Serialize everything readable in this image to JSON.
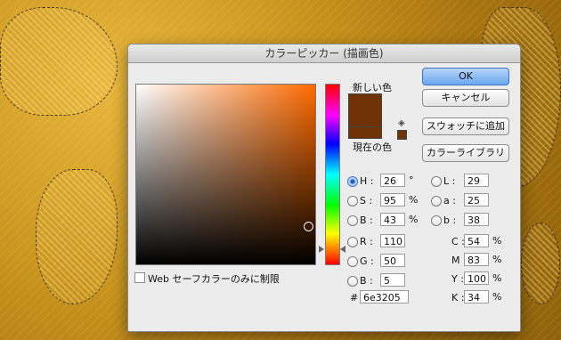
{
  "dialog": {
    "title": "カラーピッカー (描画色)",
    "new_label": "新しい色",
    "current_label": "現在の色",
    "new_color": "#6e3205",
    "current_color": "#6e3205"
  },
  "buttons": {
    "ok": "OK",
    "cancel": "キャンセル",
    "swatches": "スウォッチに追加",
    "libraries": "カラーライブラリ"
  },
  "fields": {
    "H": {
      "label": "H :",
      "value": "26",
      "unit": "°"
    },
    "S": {
      "label": "S :",
      "value": "95",
      "unit": "%"
    },
    "Bv": {
      "label": "B :",
      "value": "43",
      "unit": "%"
    },
    "R": {
      "label": "R :",
      "value": "110"
    },
    "G": {
      "label": "G :",
      "value": "50"
    },
    "Bb": {
      "label": "B :",
      "value": "5"
    },
    "L": {
      "label": "L :",
      "value": "29"
    },
    "a": {
      "label": "a :",
      "value": "25"
    },
    "b": {
      "label": "b :",
      "value": "38"
    },
    "C": {
      "label": "C :",
      "value": "54",
      "unit": "%"
    },
    "M": {
      "label": "M :",
      "value": "83",
      "unit": "%"
    },
    "Y": {
      "label": "Y :",
      "value": "100",
      "unit": "%"
    },
    "K": {
      "label": "K :",
      "value": "34",
      "unit": "%"
    }
  },
  "hex": {
    "label": "#",
    "value": "6e3205"
  },
  "web_only": {
    "label": "Web セーフカラーのみに制限",
    "checked": false
  }
}
